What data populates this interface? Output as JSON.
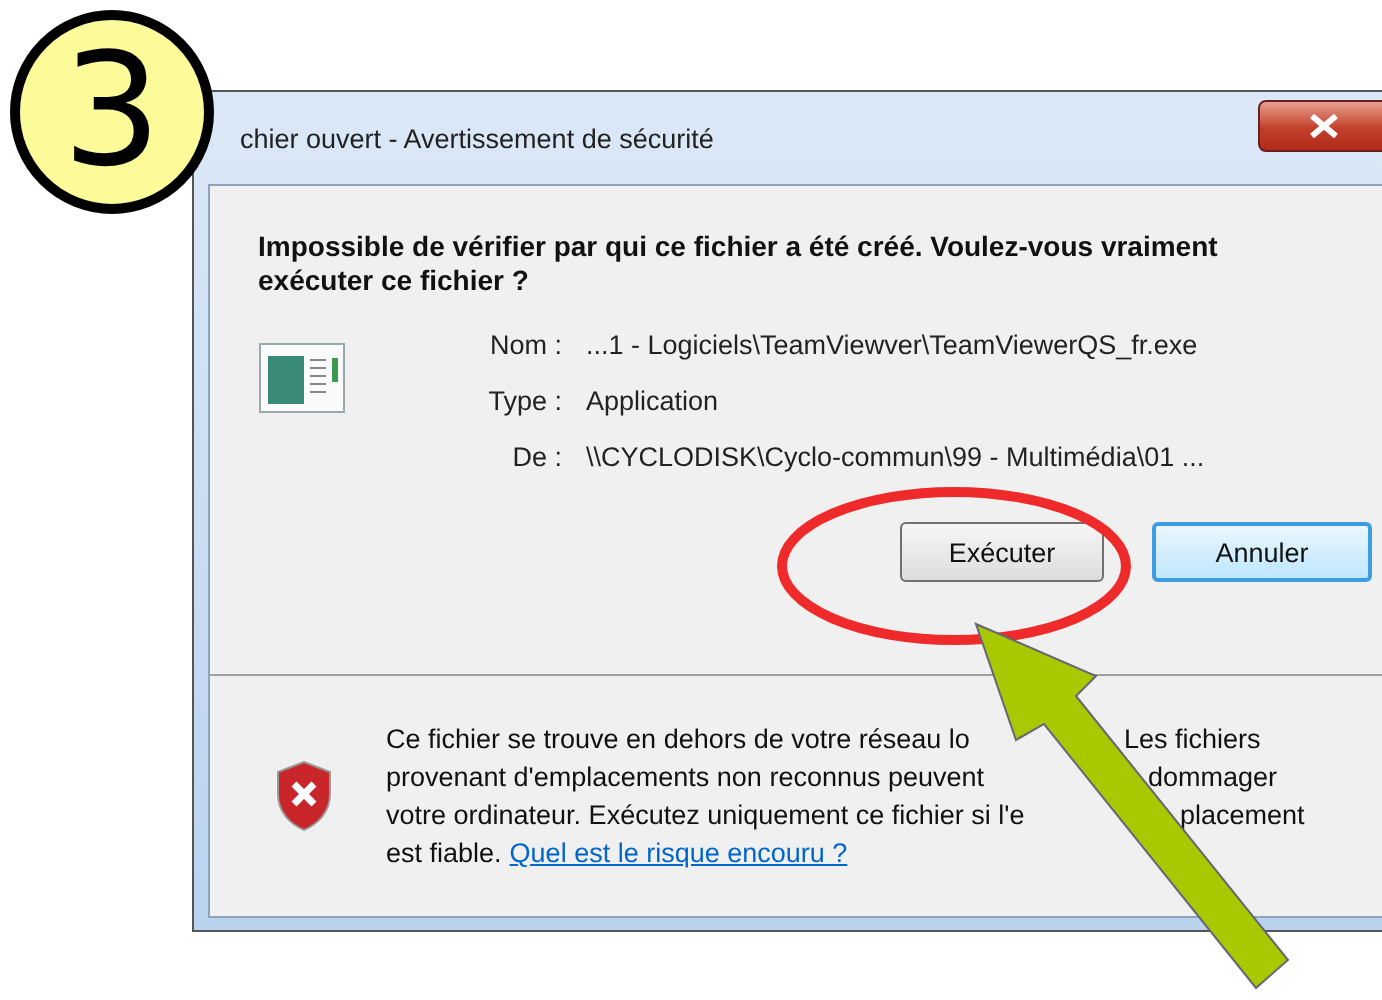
{
  "step_badge": {
    "text": "3"
  },
  "window": {
    "title": "chier ouvert - Avertissement de sécurité"
  },
  "dialog": {
    "heading": "Impossible de vérifier par qui ce fichier a été créé. Voulez-vous vraiment exécuter ce fichier ?",
    "fields": [
      {
        "label": "Nom :",
        "value": "...1 - Logiciels\\TeamViewver\\TeamViewerQS_fr.exe"
      },
      {
        "label": "Type :",
        "value": "Application"
      },
      {
        "label": "De :",
        "value": "\\\\CYCLODISK\\Cyclo-commun\\99 - Multimédia\\01 ..."
      }
    ],
    "buttons": [
      {
        "label": "Exécuter",
        "focused": false
      },
      {
        "label": "Annuler",
        "focused": true
      }
    ],
    "warning": {
      "lines": [
        {
          "parts": [
            "Ce fichier se trouve en dehors de votre réseau lo",
            "Les fichiers"
          ]
        },
        {
          "parts": [
            "provenant d'emplacements non reconnus peuvent",
            "dommager"
          ]
        },
        {
          "parts": [
            "votre ordinateur. Exécutez uniquement ce fichier si l'e",
            "placement"
          ]
        },
        {
          "parts": [
            "est fiable."
          ]
        }
      ],
      "link": "Quel est le risque encouru ?"
    }
  }
}
